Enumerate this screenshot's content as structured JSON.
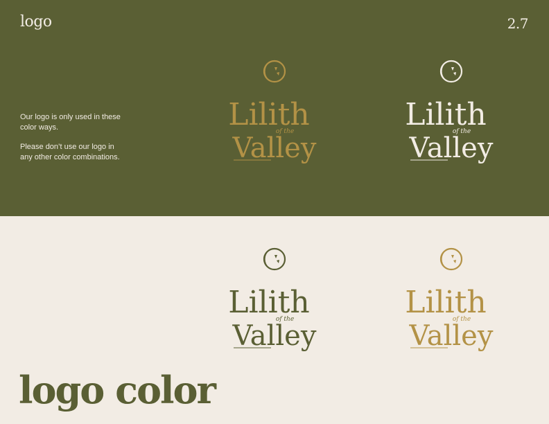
{
  "header": {
    "section_label": "logo",
    "page_number": "2.7"
  },
  "notes": [
    "Our logo is only used in these color ways.",
    "Please don’t use our logo in any other color combinations."
  ],
  "page_title": "logo color",
  "logo_wordmark": {
    "line1": "Lilith",
    "line2": "of the",
    "line3": "Valley"
  },
  "palette": {
    "olive": "#5a5f34",
    "cream": "#f2ece4",
    "gold": "#b39246"
  },
  "logo_variants": [
    {
      "background": "olive",
      "color": "gold"
    },
    {
      "background": "olive",
      "color": "cream"
    },
    {
      "background": "cream",
      "color": "olive"
    },
    {
      "background": "cream",
      "color": "gold"
    }
  ]
}
